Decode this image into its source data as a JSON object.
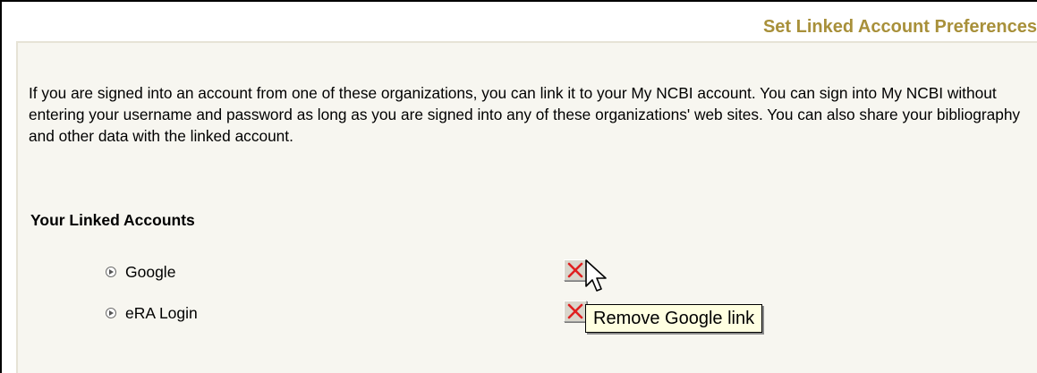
{
  "panel": {
    "title": "Set Linked Account Preferences",
    "intro_text": "If you are signed into an account from one of these organizations, you can link it to your My NCBI account. You can sign into My NCBI without entering your username and password as long as you are signed into any of these organizations' web sites. You can also share your bibliography and other data with the linked account."
  },
  "linked_accounts": {
    "heading": "Your Linked Accounts",
    "items": [
      {
        "label": "Google",
        "remove_icon": "x-icon",
        "bullet_icon": "arrow-bullet-icon"
      },
      {
        "label": "eRA Login",
        "remove_icon": "x-icon",
        "bullet_icon": "arrow-bullet-icon"
      }
    ]
  },
  "tooltip": {
    "text": "Remove Google link"
  },
  "colors": {
    "title": "#a8903a",
    "panel_background": "#f7f6f0",
    "remove_x": "#e02020",
    "tooltip_background": "#ffffe1"
  },
  "cursor": {
    "icon": "arrow-pointer-icon"
  }
}
